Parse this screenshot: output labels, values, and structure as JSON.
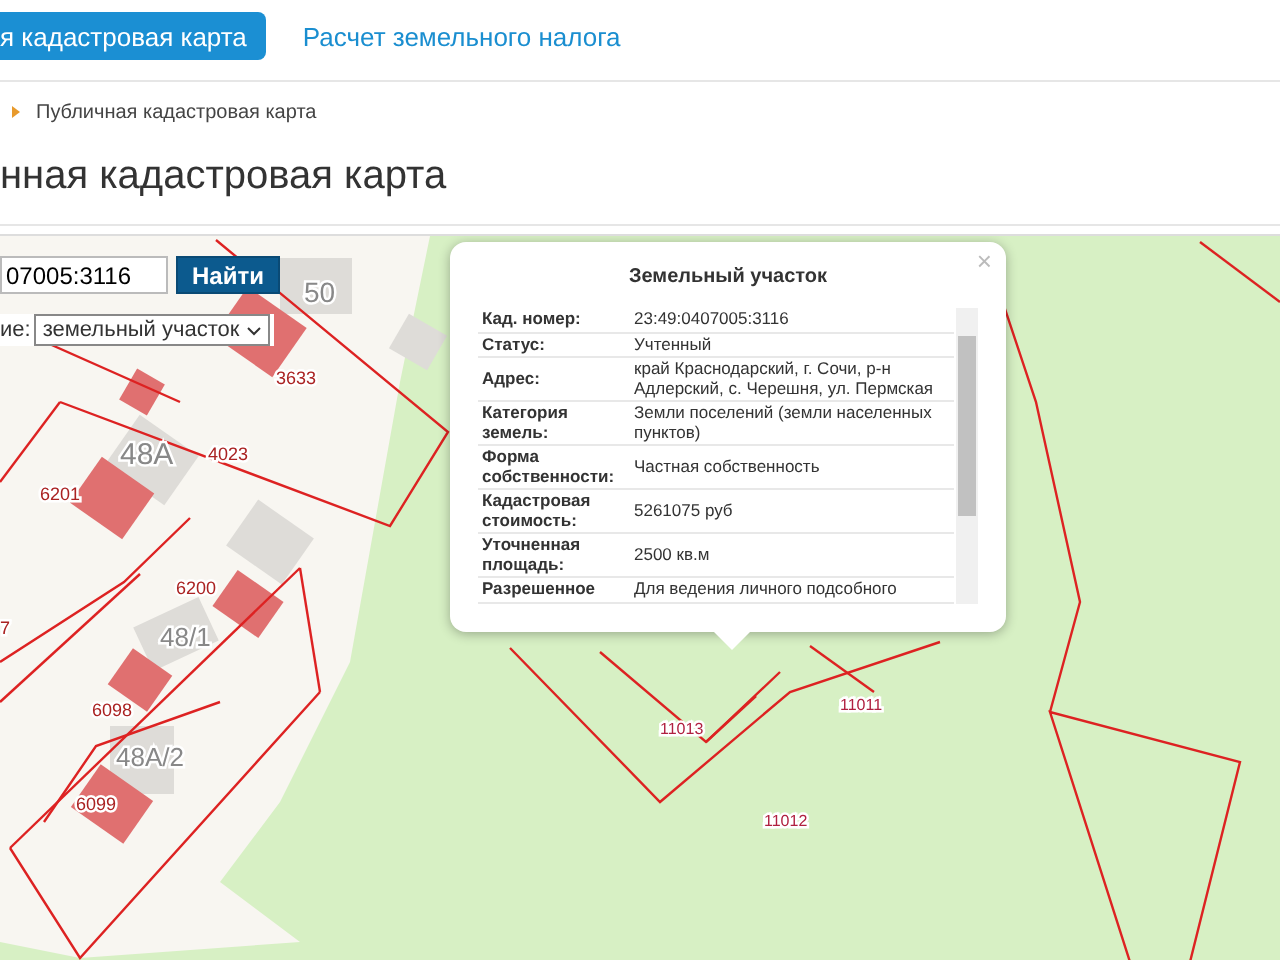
{
  "tabs": [
    {
      "label": "я кадастровая карта",
      "selected": true
    },
    {
      "label": "Расчет земельного налога",
      "selected": false
    }
  ],
  "breadcrumb": {
    "items": [
      "Публичная кадастровая карта"
    ]
  },
  "heading": "нная кадастровая карта",
  "search": {
    "value": "07005:3116",
    "button": "Найти",
    "type_label": "ие:",
    "type_value": "земельный участок"
  },
  "map_labels": [
    "50",
    "3633",
    "4023",
    "48А",
    "6201",
    "6200",
    "48/1",
    "6098",
    "48А/2",
    "6099",
    "7",
    "11013",
    "11011",
    "11012"
  ],
  "popup": {
    "title": "Земельный участок",
    "close": "×",
    "rows": [
      {
        "label": "Кад. номер:",
        "value": "23:49:0407005:3116"
      },
      {
        "label": "Статус:",
        "value": "Учтенный"
      },
      {
        "label": "Адрес:",
        "value": "край Краснодарский, г. Сочи, р-н Адлерский, с. Черешня, ул. Пермская"
      },
      {
        "label": "Категория земель:",
        "value": "Земли поселений (земли населенных пунктов)"
      },
      {
        "label": "Форма собственности:",
        "value": "Частная собственность"
      },
      {
        "label": "Кадастровая стоимость:",
        "value": "5261075 руб"
      },
      {
        "label": "Уточненная площадь:",
        "value": "2500 кв.м"
      },
      {
        "label": "Разрешенное",
        "value": "Для ведения личного подсобного"
      }
    ]
  }
}
